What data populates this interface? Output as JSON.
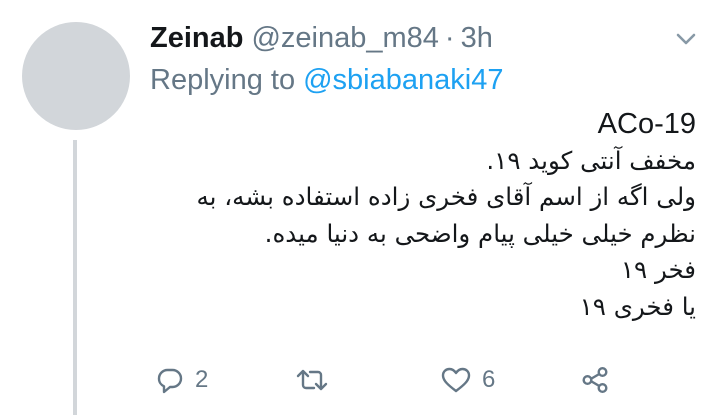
{
  "tweet": {
    "author": {
      "display_name": "Zeinab",
      "handle": "@zeinab_m84",
      "separator": "·",
      "time": "3h"
    },
    "replying_to": {
      "label": "Replying to",
      "mention": "@sbiabanaki47"
    },
    "body_lines": [
      "ACo-19",
      "مخفف آنتی کوید ۱۹.",
      "ولی اگه از اسم آقای فخری زاده استفاده بشه، به",
      "نظرم خیلی خیلی پیام واضحی به دنیا میده.",
      "فخر ۱۹",
      "یا فخری ۱۹"
    ],
    "actions": {
      "reply_count": "2",
      "retweet_count": "",
      "like_count": "6"
    }
  },
  "icons": {
    "caret": "chevron-down-icon",
    "reply": "reply-icon",
    "retweet": "retweet-icon",
    "like": "heart-icon",
    "share": "share-icon"
  },
  "colors": {
    "text": "#14171a",
    "secondary": "#657786",
    "link": "#1da1f2",
    "avatar": "#d2d6da"
  }
}
